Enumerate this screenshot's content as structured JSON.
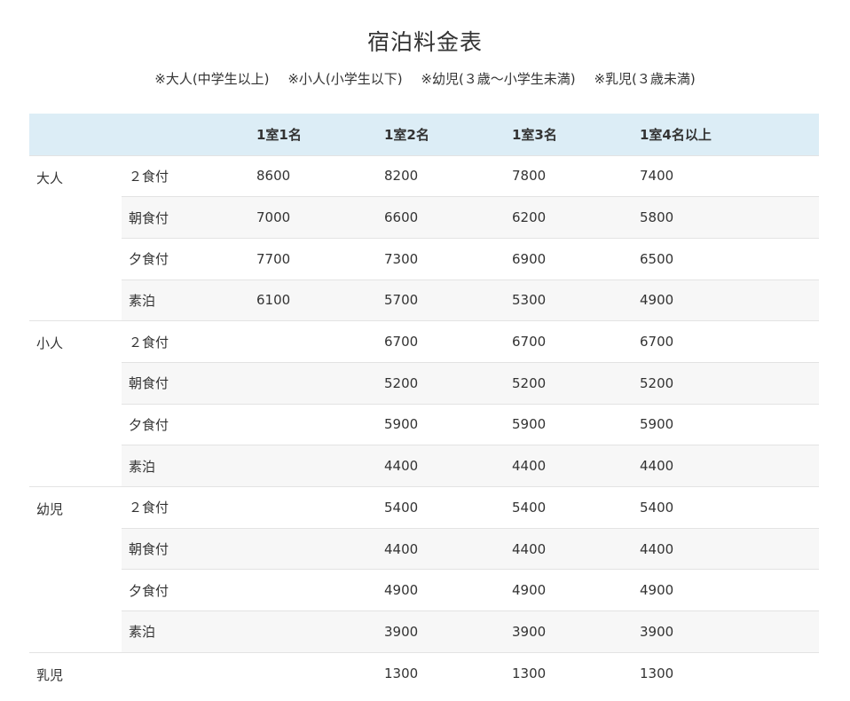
{
  "title": "宿泊料金表",
  "notes": [
    "※大人(中学生以上)",
    "※小人(小学生以下)",
    "※幼児(３歳〜小学生未満)",
    "※乳児(３歳未満)"
  ],
  "table": {
    "headers": [
      "",
      "",
      "1室1名",
      "1室2名",
      "1室3名",
      "1室4名以上"
    ],
    "groups": [
      {
        "category": "大人",
        "rows": [
          {
            "meal": "２食付",
            "values": [
              "8600",
              "8200",
              "7800",
              "7400"
            ]
          },
          {
            "meal": "朝食付",
            "values": [
              "7000",
              "6600",
              "6200",
              "5800"
            ]
          },
          {
            "meal": "夕食付",
            "values": [
              "7700",
              "7300",
              "6900",
              "6500"
            ]
          },
          {
            "meal": "素泊",
            "values": [
              "6100",
              "5700",
              "5300",
              "4900"
            ]
          }
        ]
      },
      {
        "category": "小人",
        "rows": [
          {
            "meal": "２食付",
            "values": [
              "",
              "6700",
              "6700",
              "6700"
            ]
          },
          {
            "meal": "朝食付",
            "values": [
              "",
              "5200",
              "5200",
              "5200"
            ]
          },
          {
            "meal": "夕食付",
            "values": [
              "",
              "5900",
              "5900",
              "5900"
            ]
          },
          {
            "meal": "素泊",
            "values": [
              "",
              "4400",
              "4400",
              "4400"
            ]
          }
        ]
      },
      {
        "category": "幼児",
        "rows": [
          {
            "meal": "２食付",
            "values": [
              "",
              "5400",
              "5400",
              "5400"
            ]
          },
          {
            "meal": "朝食付",
            "values": [
              "",
              "4400",
              "4400",
              "4400"
            ]
          },
          {
            "meal": "夕食付",
            "values": [
              "",
              "4900",
              "4900",
              "4900"
            ]
          },
          {
            "meal": "素泊",
            "values": [
              "",
              "3900",
              "3900",
              "3900"
            ]
          }
        ]
      },
      {
        "category": "乳児",
        "rows": [
          {
            "meal": "",
            "values": [
              "",
              "1300",
              "1300",
              "1300"
            ]
          }
        ]
      }
    ]
  }
}
